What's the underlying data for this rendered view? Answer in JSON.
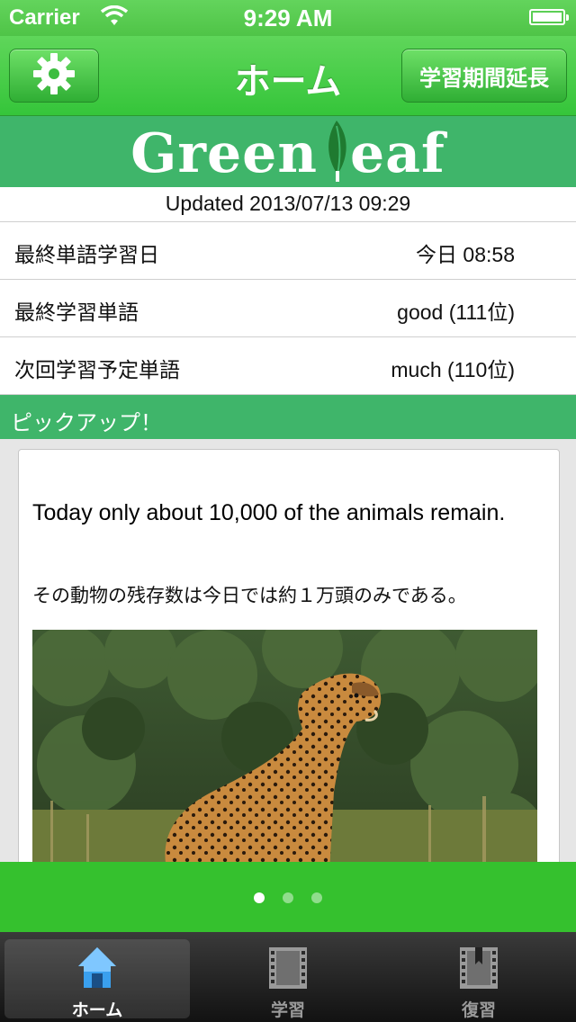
{
  "status_bar": {
    "carrier": "Carrier",
    "time": "9:29 AM",
    "battery_level": 1.0
  },
  "nav": {
    "title": "ホーム",
    "extend_button": "学習期間延長",
    "settings_icon": "gear-icon"
  },
  "logo": {
    "text_left": "Green",
    "text_right": "eaf",
    "icon": "leaf-icon"
  },
  "updated": "Updated 2013/07/13 09:29",
  "stats": [
    {
      "label": "最終単語学習日",
      "value": "今日 08:58"
    },
    {
      "label": "最終学習単語",
      "value": "good (111位)"
    },
    {
      "label": "次回学習予定単語",
      "value": "much (110位)"
    }
  ],
  "pickup": {
    "header": "ピックアップ！",
    "sentence_en": "Today only about 10,000 of the animals remain.",
    "sentence_ja": "その動物の残存数は今日では約１万頭のみである。",
    "image": "cheetah-photo"
  },
  "pager": {
    "count": 3,
    "current": 0
  },
  "tabs": [
    {
      "label": "ホーム",
      "icon": "home-icon",
      "active": true
    },
    {
      "label": "学習",
      "icon": "film-icon",
      "active": false
    },
    {
      "label": "復習",
      "icon": "bookmark-film-icon",
      "active": false
    }
  ],
  "colors": {
    "nav_green": "#35c53a",
    "band_green": "#3fb56a",
    "bottom_green": "#35c12e"
  }
}
